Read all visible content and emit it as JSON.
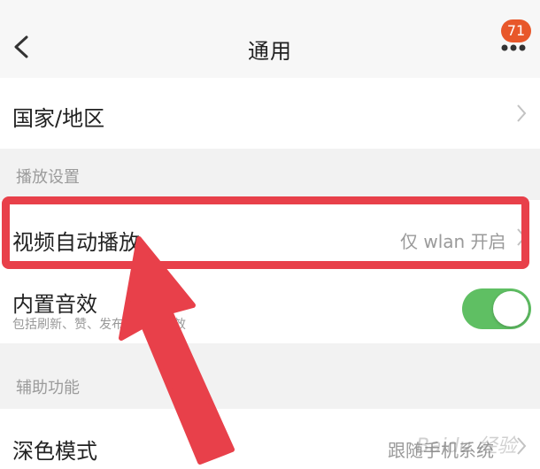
{
  "nav": {
    "title": "通用",
    "badge_count": "71"
  },
  "rows": {
    "region": {
      "label": "国家/地区"
    },
    "autoplay": {
      "label": "视频自动播放",
      "value": "仅 wlan 开启"
    },
    "sound": {
      "label": "内置音效",
      "sub": "包括刷新、赞、发布等操作音效",
      "enabled": true
    },
    "dark": {
      "label": "深色模式",
      "value": "跟随手机系统"
    }
  },
  "sections": {
    "playback": "播放设置",
    "assist": "辅助功能"
  },
  "watermark": "Baidu 经验",
  "colors": {
    "accent_toggle": "#5fbf63",
    "highlight": "#e8404a",
    "badge": "#e8572a"
  }
}
